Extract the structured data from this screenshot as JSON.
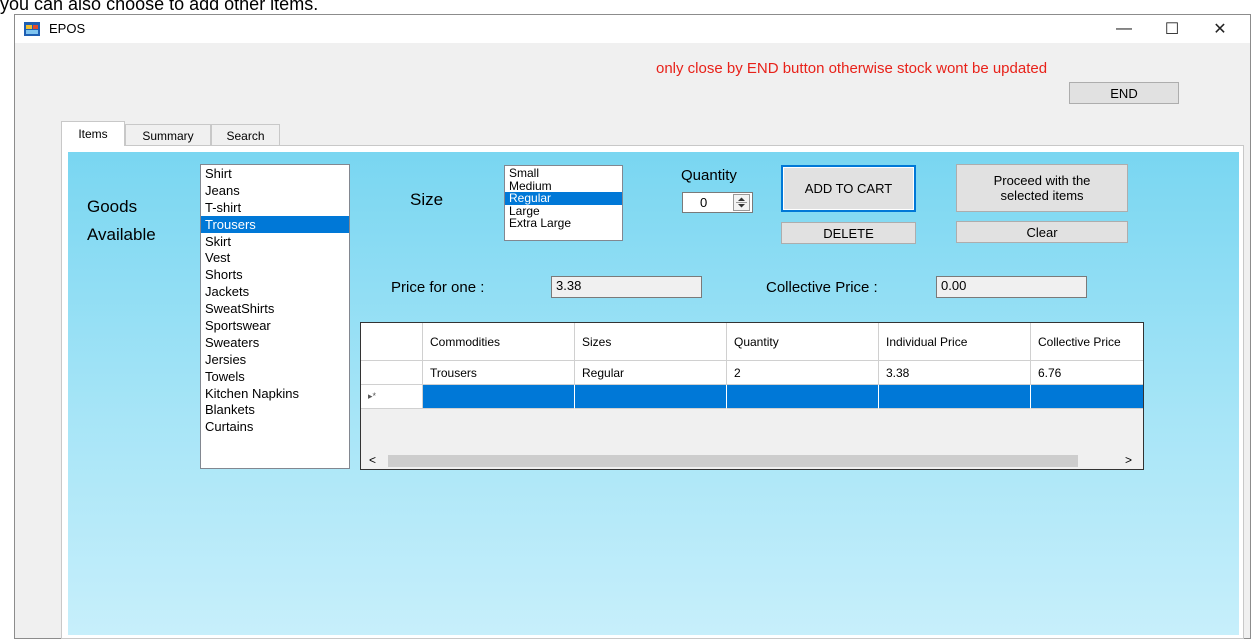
{
  "caption": "you can also choose to add other items.",
  "window": {
    "title": "EPOS",
    "minimize": "—",
    "maximize": "☐",
    "close": "✕"
  },
  "warning": "only close by END button otherwise stock wont be updated",
  "end_button": "END",
  "tabs": [
    "Items",
    "Summary",
    "Search"
  ],
  "goods_label_1": "Goods",
  "goods_label_2": "Available",
  "goods": [
    "Shirt",
    "Jeans",
    "T-shirt",
    "Trousers",
    "Skirt",
    "Vest",
    "Shorts",
    "Jackets",
    "SweatShirts",
    "Sportswear",
    "Sweaters",
    "Jersies",
    "Towels",
    "Kitchen Napkins",
    "Blankets",
    "Curtains"
  ],
  "goods_selected": "Trousers",
  "size_label": "Size",
  "sizes": [
    "Small",
    "Medium",
    "Regular",
    "Large",
    "Extra Large"
  ],
  "size_selected": "Regular",
  "quantity_label": "Quantity",
  "quantity_value": "0",
  "add_to_cart": "ADD TO CART",
  "delete": "DELETE",
  "proceed": "Proceed with the selected items",
  "clear": "Clear",
  "price_one_label": "Price for one :",
  "price_one_value": "3.38",
  "collective_label": "Collective Price :",
  "collective_value": "0.00",
  "grid": {
    "headers": [
      "Commodities",
      "Sizes",
      "Quantity",
      "Individual Price",
      "Collective Price"
    ],
    "rows": [
      [
        "Trousers",
        "Regular",
        "2",
        "3.38",
        "6.76"
      ]
    ],
    "new_row_marker": "▸*"
  },
  "scroll_left": "<",
  "scroll_right": ">",
  "colors": {
    "warning": "#e8221a",
    "selection": "#0078d7",
    "panel_top": "#79d6f1",
    "panel_bottom": "#c7effb"
  }
}
